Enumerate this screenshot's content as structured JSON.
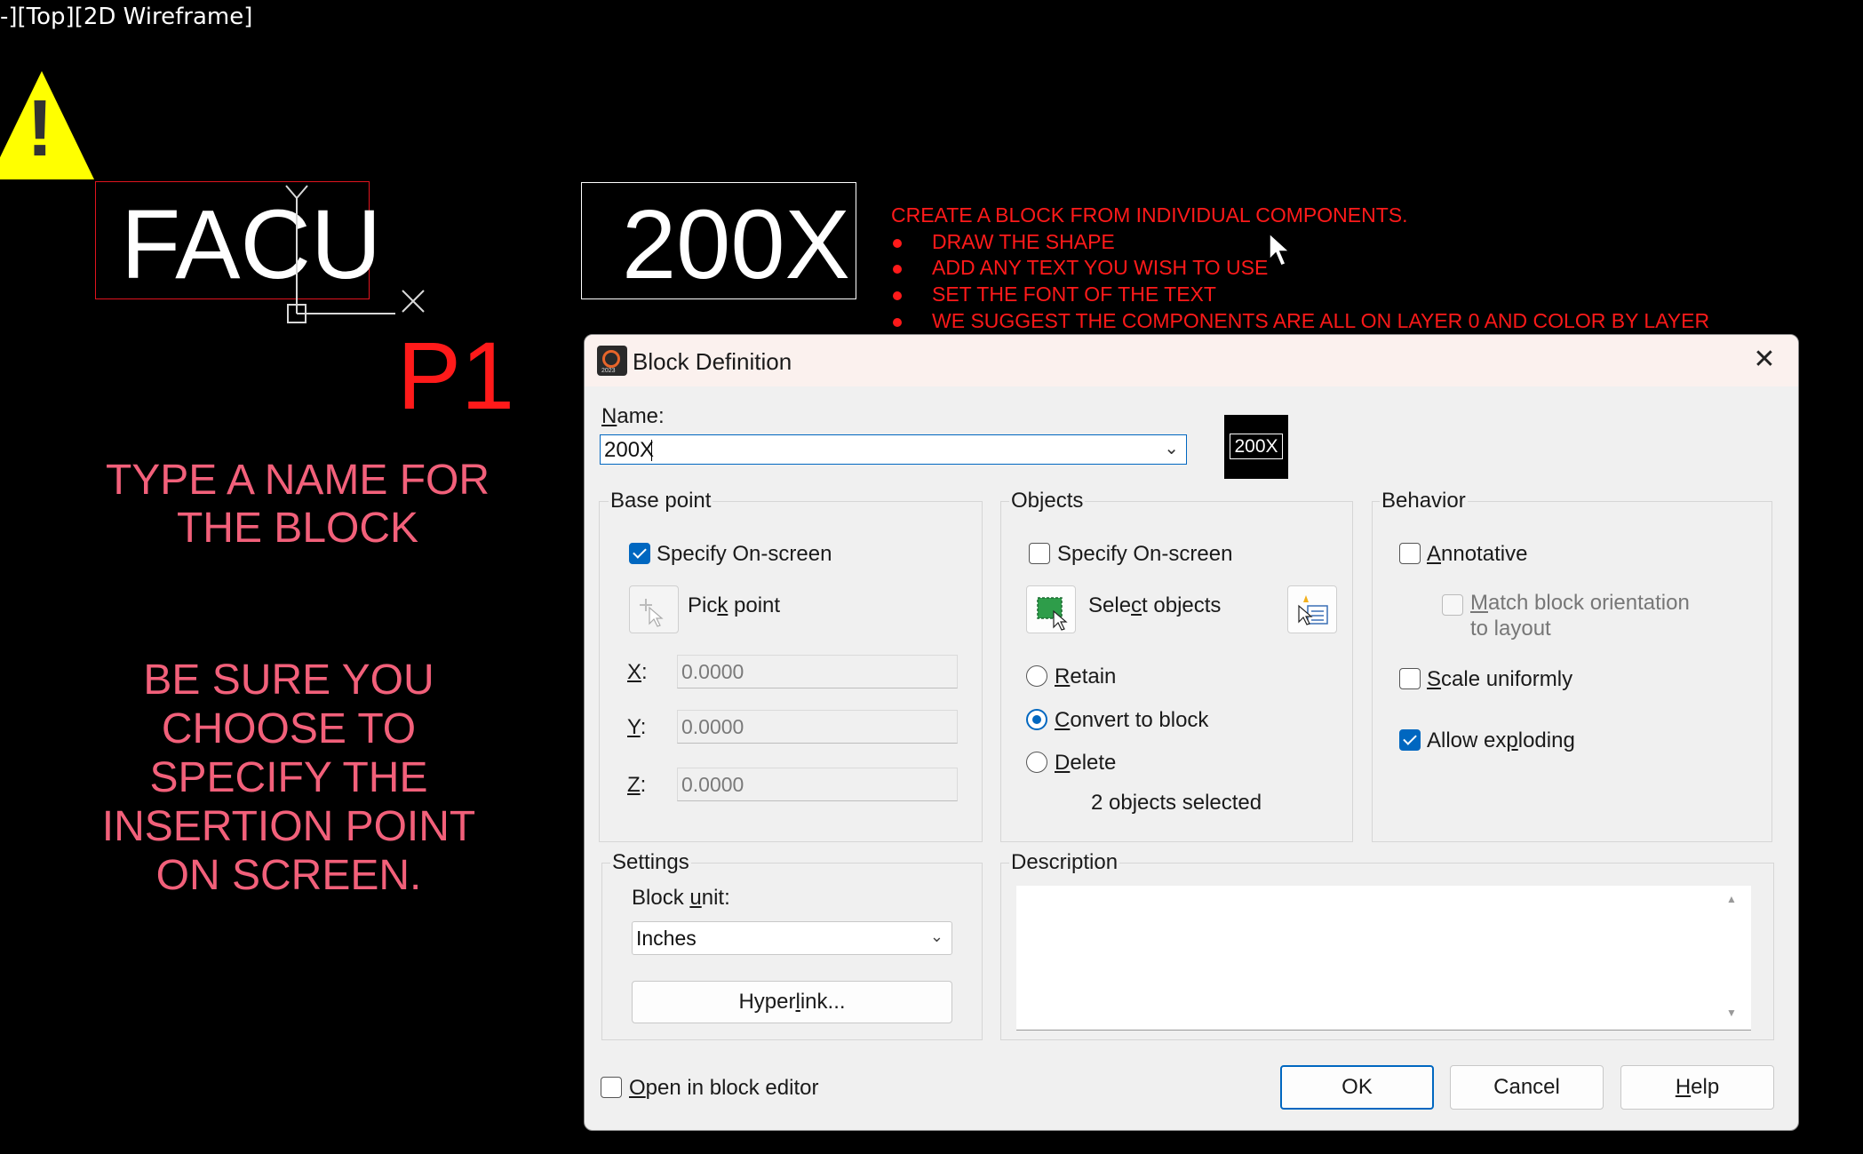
{
  "canvas": {
    "viewport_label": "-][Top][2D Wireframe]",
    "block_a_text": "FACU",
    "block_b_text": "200X",
    "p1_label": "P1",
    "hint_name": "TYPE A NAME FOR THE BLOCK",
    "hint_insert": "BE SURE YOU CHOOSE TO SPECIFY THE INSERTION POINT ON SCREEN.",
    "instructions_title": "CREATE A BLOCK FROM INDIVIDUAL COMPONENTS.",
    "instructions": [
      "DRAW THE SHAPE",
      "ADD ANY TEXT YOU WISH TO USE",
      "SET THE FONT OF THE TEXT",
      "WE SUGGEST THE COMPONENTS ARE ALL ON LAYER 0 AND COLOR BY LAYER"
    ],
    "warning_glyph": "!"
  },
  "dialog": {
    "title": "Block Definition",
    "app_icon_caption": "2023",
    "close_glyph": "✕",
    "name_label_u": "N",
    "name_label_rest": "ame:",
    "name_value": "200X",
    "preview_text": "200X",
    "base_point": {
      "title": "Base point",
      "specify_label": "Specify On-screen",
      "pick_point_pre": "Pic",
      "pick_point_u": "k",
      "pick_point_post": " point",
      "x_label": "X",
      "y_label": "Y",
      "z_label": "Z",
      "colon": ":",
      "x_value": "0.0000",
      "y_value": "0.0000",
      "z_value": "0.0000"
    },
    "objects": {
      "title": "Objects",
      "specify_label": "Specify On-screen",
      "select_pre": "Sele",
      "select_u": "c",
      "select_post": "t objects",
      "retain_u": "R",
      "retain_rest": "etain",
      "convert_u": "C",
      "convert_rest": "onvert to block",
      "delete_u": "D",
      "delete_rest": "elete",
      "count_text": "2 objects selected"
    },
    "behavior": {
      "title": "Behavior",
      "annotative_u": "A",
      "annotative_rest": "nnotative",
      "match_u": "M",
      "match_rest": "atch block orientation",
      "match_line2": "to layout",
      "scale_u": "S",
      "scale_rest": "cale uniformly",
      "explode_pre": "Allow ex",
      "explode_u": "p",
      "explode_post": "loding"
    },
    "settings": {
      "title": "Settings",
      "block_unit_pre": "Block ",
      "block_unit_u": "u",
      "block_unit_post": "nit:",
      "unit_value": "Inches",
      "hyperlink_pre": "Hyper",
      "hyperlink_u": "l",
      "hyperlink_post": "ink..."
    },
    "description": {
      "title": "Description",
      "value": ""
    },
    "open_editor_u": "O",
    "open_editor_rest": "pen in block editor",
    "ok_label": "OK",
    "cancel_label": "Cancel",
    "help_u": "H",
    "help_rest": "elp"
  },
  "colors": {
    "accent": "#0067c0",
    "cad_red": "#ff1a1a",
    "hint_pink": "#f2607a",
    "warning_yellow": "#ffff00"
  }
}
